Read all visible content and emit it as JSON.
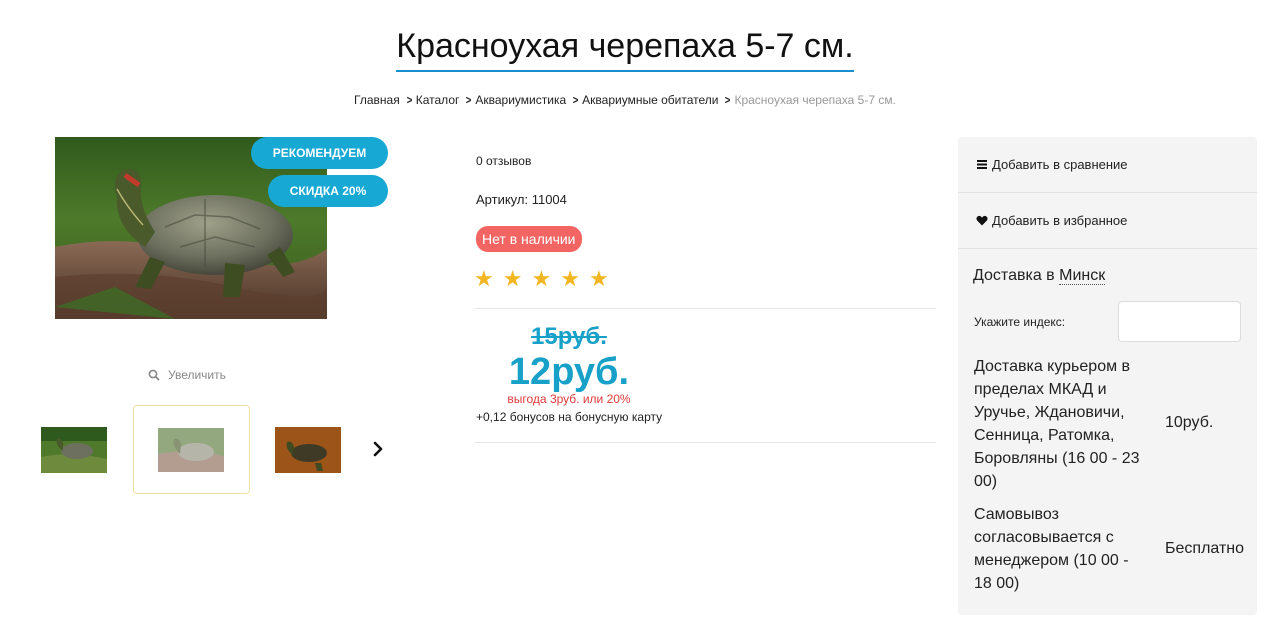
{
  "page": {
    "title": "Красноухая черепаха 5-7 см."
  },
  "breadcrumb": {
    "items": [
      "Главная",
      "Каталог",
      "Аквариумистика",
      "Аквариумные обитатели"
    ],
    "current": "Красноухая черепаха 5-7 см."
  },
  "gallery": {
    "badges": {
      "recommend": "РЕКОМЕНДУЕМ",
      "discount": "СКИДКА 20%"
    },
    "zoom_label": "Увеличить"
  },
  "product": {
    "reviews": "0 отзывов",
    "article_label": "Артикул:",
    "article_value": "11004",
    "stock_status": "Нет в наличии",
    "rating": 5,
    "rating_max": 5,
    "old_price": "15руб.",
    "new_price": "12руб.",
    "saving": "выгода 3руб. или 20%",
    "bonus": "+0,12 бонусов на бонусную карту"
  },
  "sidebar": {
    "compare_label": "Добавить в сравнение",
    "favorite_label": "Добавить в избранное",
    "delivery_prefix": "Доставка в",
    "delivery_city": "Минск",
    "index_label": "Укажите индекс:",
    "index_value": "",
    "options": [
      {
        "name": "Доставка курьером в пределах МКАД и Уручье, Ждановичи, Сенница, Ратомка, Боровляны (16 00 - 23 00)",
        "price": "10руб."
      },
      {
        "name": "Самовывоз согласовывается с менеджером (10 00 - 18 00)",
        "price": "Бесплатно"
      }
    ]
  },
  "colors": {
    "accent": "#17a8d4",
    "price": "#17a0c8",
    "out_of_stock": "#f26563",
    "star": "#f2b623",
    "saving": "#e23b3b"
  }
}
